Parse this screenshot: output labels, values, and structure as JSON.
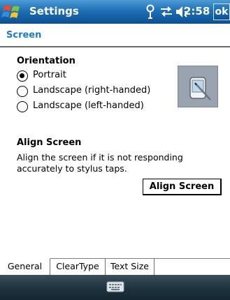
{
  "titlebar": {
    "app_title": "Settings",
    "clock": "2:58",
    "ok_label": "ok"
  },
  "page": {
    "header": "Screen"
  },
  "orientation": {
    "heading": "Orientation",
    "options": [
      "Portrait",
      "Landscape (right-handed)",
      "Landscape (left-handed)"
    ],
    "selected": "Portrait"
  },
  "align": {
    "heading": "Align Screen",
    "description": "Align the screen if it is not responding accurately to stylus taps.",
    "button_label": "Align Screen"
  },
  "tabs": [
    {
      "label": "General",
      "active": true
    },
    {
      "label": "ClearType",
      "active": false
    },
    {
      "label": "Text Size",
      "active": false
    }
  ],
  "icons": {
    "start": "windows-flag-icon",
    "status": [
      "signal-icon",
      "connectivity-icon",
      "volume-icon"
    ],
    "menubar": "keyboard-icon",
    "device": "device-stylus-icon"
  }
}
